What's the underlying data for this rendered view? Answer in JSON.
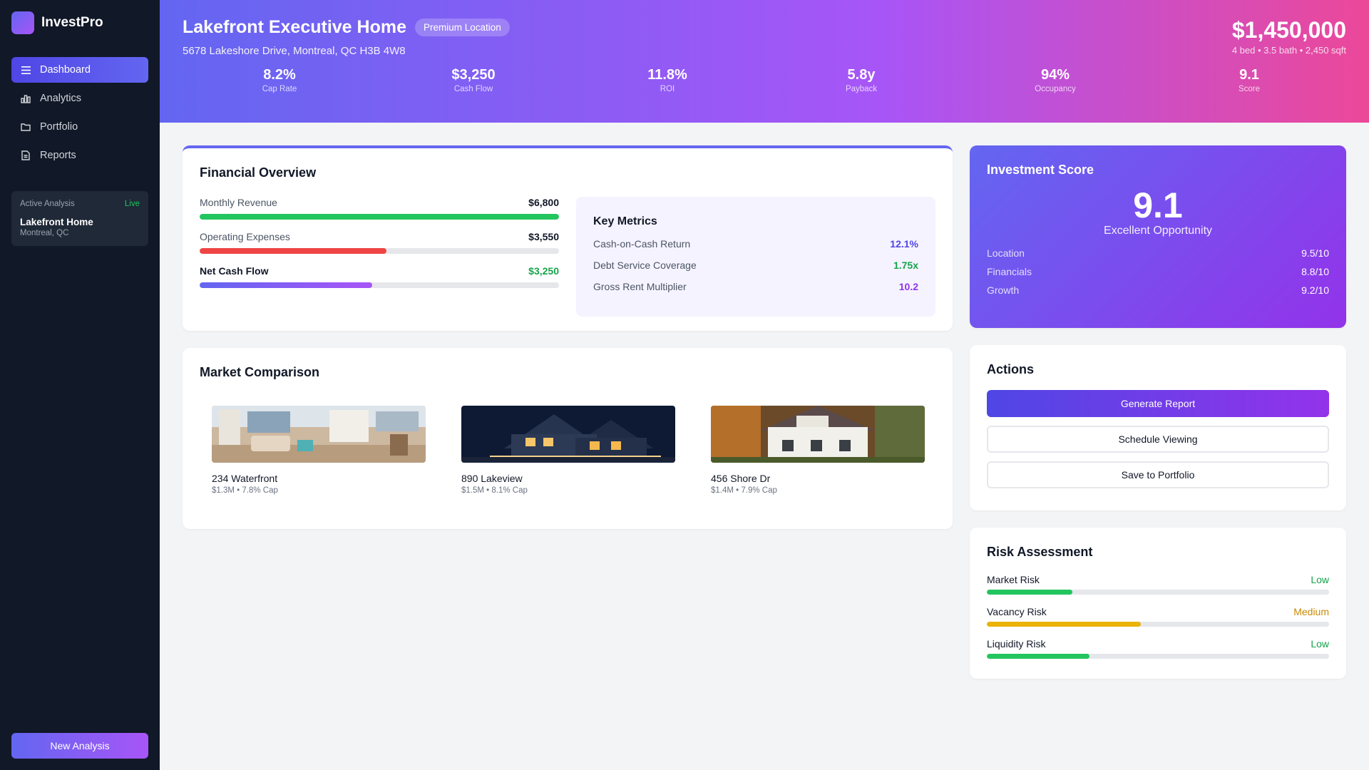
{
  "app": {
    "name": "InvestPro"
  },
  "sidebar": {
    "items": [
      {
        "label": "Dashboard",
        "icon": "menu-icon",
        "active": true
      },
      {
        "label": "Analytics",
        "icon": "bar-chart-icon",
        "active": false
      },
      {
        "label": "Portfolio",
        "icon": "folder-icon",
        "active": false
      },
      {
        "label": "Reports",
        "icon": "document-icon",
        "active": false
      }
    ],
    "active_analysis": {
      "heading": "Active Analysis",
      "status": "Live",
      "title": "Lakefront Home",
      "location": "Montreal, QC"
    },
    "new_button": "New Analysis"
  },
  "hero": {
    "title": "Lakefront Executive Home",
    "badge": "Premium Location",
    "address": "5678 Lakeshore Drive, Montreal, QC H3B 4W8",
    "price": "$1,450,000",
    "details": "4 bed • 3.5 bath • 2,450 sqft",
    "stats": [
      {
        "value": "8.2%",
        "label": "Cap Rate"
      },
      {
        "value": "$3,250",
        "label": "Cash Flow"
      },
      {
        "value": "11.8%",
        "label": "ROI"
      },
      {
        "value": "5.8y",
        "label": "Payback"
      },
      {
        "value": "94%",
        "label": "Occupancy"
      },
      {
        "value": "9.1",
        "label": "Score"
      }
    ]
  },
  "financial": {
    "title": "Financial Overview",
    "bars": [
      {
        "label": "Monthly Revenue",
        "value": "$6,800",
        "fill": 1.0,
        "color": "#22c55e"
      },
      {
        "label": "Operating Expenses",
        "value": "$3,550",
        "fill": 0.52,
        "color": "#ef4444"
      },
      {
        "label": "Net Cash Flow",
        "value": "$3,250",
        "fill": 0.48,
        "color": "#8b5cf6"
      }
    ],
    "key_metrics": {
      "title": "Key Metrics",
      "rows": [
        {
          "label": "Cash-on-Cash Return",
          "value": "12.1%",
          "color": "#4f46e5"
        },
        {
          "label": "Debt Service Coverage",
          "value": "1.75x",
          "color": "#16a34a"
        },
        {
          "label": "Gross Rent Multiplier",
          "value": "10.2",
          "color": "#9333ea"
        }
      ]
    }
  },
  "market": {
    "title": "Market Comparison",
    "comps": [
      {
        "name": "234 Waterfront",
        "sub": "$1.3M • 7.8% Cap"
      },
      {
        "name": "890 Lakeview",
        "sub": "$1.5M • 8.1% Cap"
      },
      {
        "name": "456 Shore Dr",
        "sub": "$1.4M • 7.9% Cap"
      }
    ]
  },
  "score": {
    "title": "Investment Score",
    "value": "9.1",
    "caption": "Excellent Opportunity",
    "rows": [
      {
        "label": "Location",
        "value": "9.5/10"
      },
      {
        "label": "Financials",
        "value": "8.8/10"
      },
      {
        "label": "Growth",
        "value": "9.2/10"
      }
    ]
  },
  "actions": {
    "title": "Actions",
    "generate": "Generate Report",
    "schedule": "Schedule Viewing",
    "save": "Save to Portfolio"
  },
  "risk": {
    "title": "Risk Assessment",
    "items": [
      {
        "label": "Market Risk",
        "level": "Low",
        "fill": 0.25,
        "color": "#22c55e",
        "text_color": "#16a34a"
      },
      {
        "label": "Vacancy Risk",
        "level": "Medium",
        "fill": 0.45,
        "color": "#eab308",
        "text_color": "#ca8a04"
      },
      {
        "label": "Liquidity Risk",
        "level": "Low",
        "fill": 0.3,
        "color": "#22c55e",
        "text_color": "#16a34a"
      }
    ]
  }
}
